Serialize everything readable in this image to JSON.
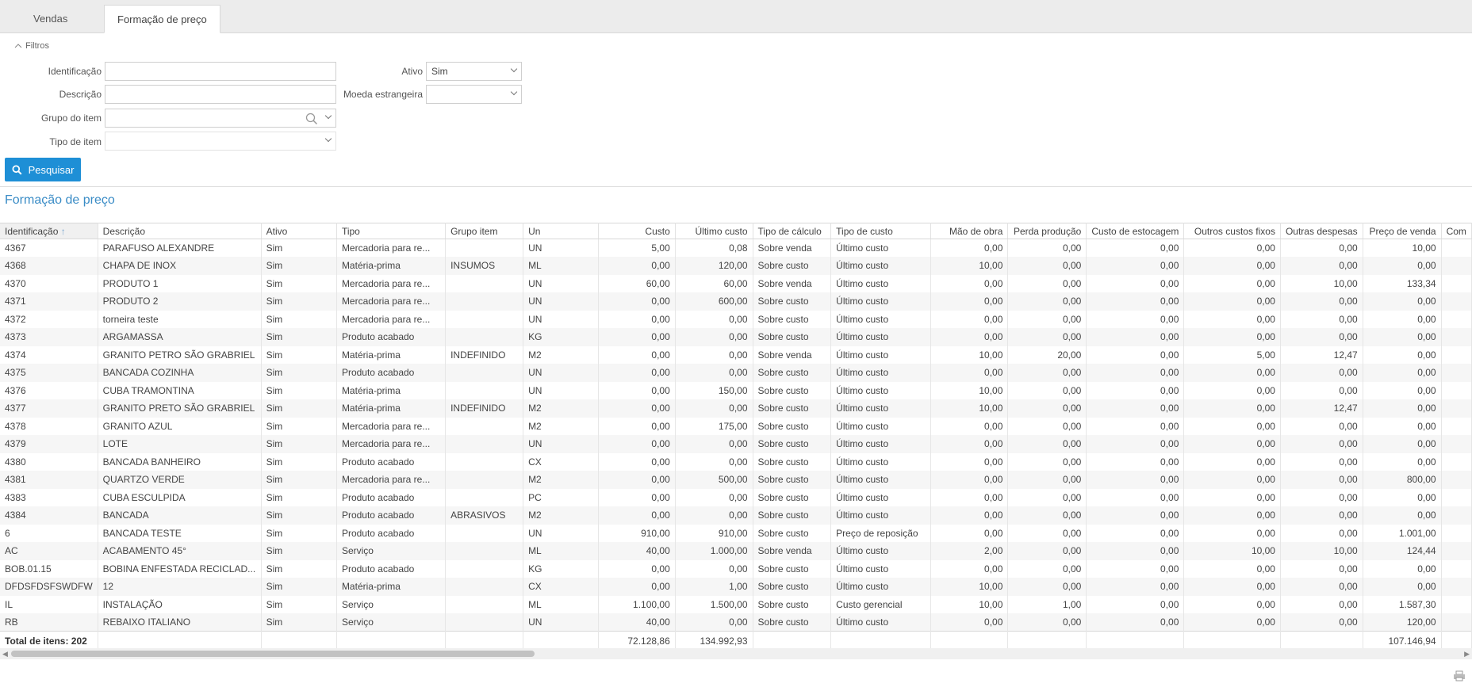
{
  "tabs": [
    "Vendas",
    "Formação de preço"
  ],
  "filters": {
    "toggle_label": "Filtros",
    "identificacao_label": "Identificação",
    "identificacao_value": "",
    "descricao_label": "Descrição",
    "descricao_value": "",
    "grupo_label": "Grupo do item",
    "grupo_value": "",
    "tipo_label": "Tipo de item",
    "tipo_value": "",
    "ativo_label": "Ativo",
    "ativo_value": "Sim",
    "moeda_label": "Moeda estrangeira",
    "moeda_value": "",
    "search_button": "Pesquisar"
  },
  "section_title": "Formação de preço",
  "columns": [
    "Identificação",
    "Descrição",
    "Ativo",
    "Tipo",
    "Grupo item",
    "Un",
    "Custo",
    "Último custo",
    "Tipo de cálculo",
    "Tipo de custo",
    "Mão de obra",
    "Perda produção",
    "Custo de estocagem",
    "Outros custos fixos",
    "Outras despesas",
    "Preço de venda",
    "Com"
  ],
  "rows": [
    [
      "4367",
      "PARAFUSO ALEXANDRE",
      "Sim",
      "Mercadoria para re...",
      "",
      "UN",
      "5,00",
      "0,08",
      "Sobre venda",
      "Último custo",
      "0,00",
      "0,00",
      "0,00",
      "0,00",
      "0,00",
      "10,00",
      ""
    ],
    [
      "4368",
      "CHAPA DE INOX",
      "Sim",
      "Matéria-prima",
      "INSUMOS",
      "ML",
      "0,00",
      "120,00",
      "Sobre custo",
      "Último custo",
      "10,00",
      "0,00",
      "0,00",
      "0,00",
      "0,00",
      "0,00",
      ""
    ],
    [
      "4370",
      "PRODUTO 1",
      "Sim",
      "Mercadoria para re...",
      "",
      "UN",
      "60,00",
      "60,00",
      "Sobre venda",
      "Último custo",
      "0,00",
      "0,00",
      "0,00",
      "0,00",
      "10,00",
      "133,34",
      ""
    ],
    [
      "4371",
      "PRODUTO 2",
      "Sim",
      "Mercadoria para re...",
      "",
      "UN",
      "0,00",
      "600,00",
      "Sobre custo",
      "Último custo",
      "0,00",
      "0,00",
      "0,00",
      "0,00",
      "0,00",
      "0,00",
      ""
    ],
    [
      "4372",
      "torneira teste",
      "Sim",
      "Mercadoria para re...",
      "",
      "UN",
      "0,00",
      "0,00",
      "Sobre custo",
      "Último custo",
      "0,00",
      "0,00",
      "0,00",
      "0,00",
      "0,00",
      "0,00",
      ""
    ],
    [
      "4373",
      "ARGAMASSA",
      "Sim",
      "Produto acabado",
      "",
      "KG",
      "0,00",
      "0,00",
      "Sobre custo",
      "Último custo",
      "0,00",
      "0,00",
      "0,00",
      "0,00",
      "0,00",
      "0,00",
      ""
    ],
    [
      "4374",
      "GRANITO PETRO SÃO GRABRIEL",
      "Sim",
      "Matéria-prima",
      "INDEFINIDO",
      "M2",
      "0,00",
      "0,00",
      "Sobre venda",
      "Último custo",
      "10,00",
      "20,00",
      "0,00",
      "5,00",
      "12,47",
      "0,00",
      ""
    ],
    [
      "4375",
      "BANCADA COZINHA",
      "Sim",
      "Produto acabado",
      "",
      "UN",
      "0,00",
      "0,00",
      "Sobre custo",
      "Último custo",
      "0,00",
      "0,00",
      "0,00",
      "0,00",
      "0,00",
      "0,00",
      ""
    ],
    [
      "4376",
      "CUBA TRAMONTINA",
      "Sim",
      "Matéria-prima",
      "",
      "UN",
      "0,00",
      "150,00",
      "Sobre custo",
      "Último custo",
      "10,00",
      "0,00",
      "0,00",
      "0,00",
      "0,00",
      "0,00",
      ""
    ],
    [
      "4377",
      "GRANITO PRETO SÃO GRABRIEL",
      "Sim",
      "Matéria-prima",
      "INDEFINIDO",
      "M2",
      "0,00",
      "0,00",
      "Sobre custo",
      "Último custo",
      "10,00",
      "0,00",
      "0,00",
      "0,00",
      "12,47",
      "0,00",
      ""
    ],
    [
      "4378",
      "GRANITO AZUL",
      "Sim",
      "Mercadoria para re...",
      "",
      "M2",
      "0,00",
      "175,00",
      "Sobre custo",
      "Último custo",
      "0,00",
      "0,00",
      "0,00",
      "0,00",
      "0,00",
      "0,00",
      ""
    ],
    [
      "4379",
      "LOTE",
      "Sim",
      "Mercadoria para re...",
      "",
      "UN",
      "0,00",
      "0,00",
      "Sobre custo",
      "Último custo",
      "0,00",
      "0,00",
      "0,00",
      "0,00",
      "0,00",
      "0,00",
      ""
    ],
    [
      "4380",
      "BANCADA BANHEIRO",
      "Sim",
      "Produto acabado",
      "",
      "CX",
      "0,00",
      "0,00",
      "Sobre custo",
      "Último custo",
      "0,00",
      "0,00",
      "0,00",
      "0,00",
      "0,00",
      "0,00",
      ""
    ],
    [
      "4381",
      "QUARTZO VERDE",
      "Sim",
      "Mercadoria para re...",
      "",
      "M2",
      "0,00",
      "500,00",
      "Sobre custo",
      "Último custo",
      "0,00",
      "0,00",
      "0,00",
      "0,00",
      "0,00",
      "800,00",
      ""
    ],
    [
      "4383",
      "CUBA ESCULPIDA",
      "Sim",
      "Produto acabado",
      "",
      "PC",
      "0,00",
      "0,00",
      "Sobre custo",
      "Último custo",
      "0,00",
      "0,00",
      "0,00",
      "0,00",
      "0,00",
      "0,00",
      ""
    ],
    [
      "4384",
      "BANCADA",
      "Sim",
      "Produto acabado",
      "ABRASIVOS",
      "M2",
      "0,00",
      "0,00",
      "Sobre custo",
      "Último custo",
      "0,00",
      "0,00",
      "0,00",
      "0,00",
      "0,00",
      "0,00",
      ""
    ],
    [
      "6",
      "BANCADA TESTE",
      "Sim",
      "Produto acabado",
      "",
      "UN",
      "910,00",
      "910,00",
      "Sobre custo",
      "Preço de reposição",
      "0,00",
      "0,00",
      "0,00",
      "0,00",
      "0,00",
      "1.001,00",
      ""
    ],
    [
      "AC",
      "ACABAMENTO 45°",
      "Sim",
      "Serviço",
      "",
      "ML",
      "40,00",
      "1.000,00",
      "Sobre venda",
      "Último custo",
      "2,00",
      "0,00",
      "0,00",
      "10,00",
      "10,00",
      "124,44",
      ""
    ],
    [
      "BOB.01.15",
      "BOBINA ENFESTADA RECICLAD...",
      "Sim",
      "Produto acabado",
      "",
      "KG",
      "0,00",
      "0,00",
      "Sobre custo",
      "Último custo",
      "0,00",
      "0,00",
      "0,00",
      "0,00",
      "0,00",
      "0,00",
      ""
    ],
    [
      "DFDSFDSFSWDFW",
      "12",
      "Sim",
      "Matéria-prima",
      "",
      "CX",
      "0,00",
      "1,00",
      "Sobre custo",
      "Último custo",
      "10,00",
      "0,00",
      "0,00",
      "0,00",
      "0,00",
      "0,00",
      ""
    ],
    [
      "IL",
      "INSTALAÇÃO",
      "Sim",
      "Serviço",
      "",
      "ML",
      "1.100,00",
      "1.500,00",
      "Sobre custo",
      "Custo gerencial",
      "10,00",
      "1,00",
      "0,00",
      "0,00",
      "0,00",
      "1.587,30",
      ""
    ],
    [
      "RB",
      "REBAIXO ITALIANO",
      "Sim",
      "Serviço",
      "",
      "UN",
      "40,00",
      "0,00",
      "Sobre custo",
      "Último custo",
      "0,00",
      "0,00",
      "0,00",
      "0,00",
      "0,00",
      "120,00",
      ""
    ]
  ],
  "footer": {
    "total_label": "Total de itens: 202",
    "custo_total": "72.128,86",
    "ultimo_custo_total": "134.992,93",
    "preco_venda_total": "107.146,94"
  }
}
